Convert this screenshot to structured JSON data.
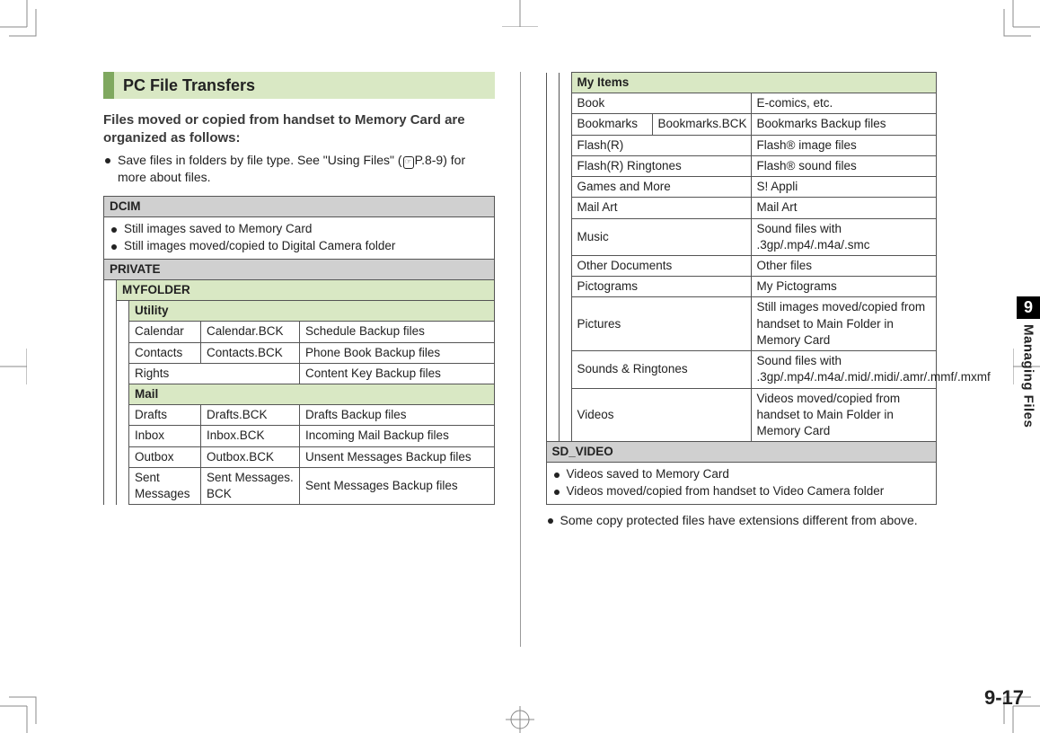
{
  "side_tab": {
    "chapter": "9",
    "label": "Managing Files"
  },
  "page_number": "9-17",
  "heading": "PC File Transfers",
  "intro": "Files moved or copied from handset to Memory Card are organized as follows:",
  "intro_bullet": {
    "pre": "Save files in folders by file type. See \"Using Files\" (",
    "ref": "P.8-9",
    "post": ") for more about files."
  },
  "dcim": {
    "title": "DCIM",
    "items": [
      "Still images saved to Memory Card",
      "Still images moved/copied to Digital Camera folder"
    ]
  },
  "private_title": "PRIVATE",
  "myfolder_title": "MYFOLDER",
  "utility": {
    "title": "Utility",
    "rows": [
      {
        "a": "Calendar",
        "b": "Calendar.BCK",
        "c": "Schedule Backup files"
      },
      {
        "a": "Contacts",
        "b": "Contacts.BCK",
        "c": "Phone Book Backup files"
      },
      {
        "a": "Rights",
        "b": "",
        "c": "Content Key Backup files"
      }
    ]
  },
  "mail": {
    "title": "Mail",
    "rows": [
      {
        "a": "Drafts",
        "b": "Drafts.BCK",
        "c": "Drafts Backup files"
      },
      {
        "a": "Inbox",
        "b": "Inbox.BCK",
        "c": "Incoming Mail Backup files"
      },
      {
        "a": "Outbox",
        "b": "Outbox.BCK",
        "c": "Unsent Messages Backup files"
      },
      {
        "a": "Sent Messages",
        "b": "Sent Messages. BCK",
        "c": "Sent Messages Backup files"
      }
    ]
  },
  "myitems": {
    "title": "My Items",
    "rows": [
      {
        "a": "Book",
        "b": "",
        "c": "E-comics, etc."
      },
      {
        "a": "Bookmarks",
        "b": "Bookmarks.BCK",
        "c": "Bookmarks Backup files"
      },
      {
        "a": "Flash(R)",
        "b": "",
        "c": "Flash® image files"
      },
      {
        "a": "Flash(R) Ringtones",
        "b": "",
        "c": "Flash® sound files"
      },
      {
        "a": "Games and More",
        "b": "",
        "c": "S! Appli"
      },
      {
        "a": "Mail Art",
        "b": "",
        "c": "Mail Art"
      },
      {
        "a": "Music",
        "b": "",
        "c": "Sound files with .3gp/.mp4/.m4a/.smc"
      },
      {
        "a": "Other Documents",
        "b": "",
        "c": "Other files"
      },
      {
        "a": "Pictograms",
        "b": "",
        "c": "My Pictograms"
      },
      {
        "a": "Pictures",
        "b": "",
        "c": "Still images moved/copied from handset to Main Folder in Memory Card"
      },
      {
        "a": "Sounds & Ringtones",
        "b": "",
        "c": "Sound files with .3gp/.mp4/.m4a/.mid/.midi/.amr/.mmf/.mxmf"
      },
      {
        "a": "Videos",
        "b": "",
        "c": "Videos moved/copied from handset to Main Folder in Memory Card"
      }
    ]
  },
  "sdvideo": {
    "title": "SD_VIDEO",
    "items": [
      "Videos saved to Memory Card",
      "Videos moved/copied from handset to Video Camera folder"
    ]
  },
  "footnote": "Some copy protected files have extensions different from above."
}
